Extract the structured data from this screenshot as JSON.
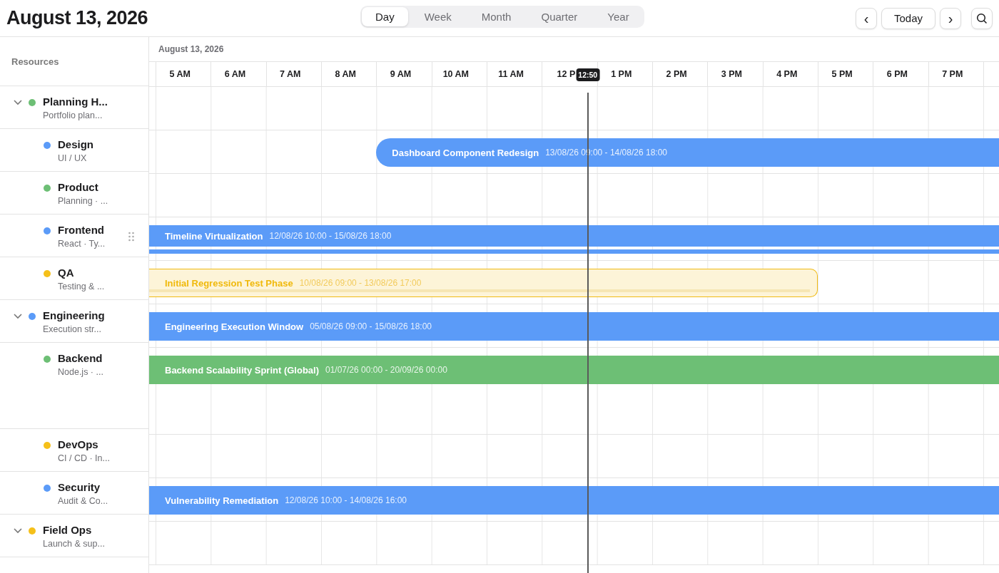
{
  "title": "August 13, 2026",
  "views": [
    {
      "label": "Day",
      "selected": true
    },
    {
      "label": "Week",
      "selected": false
    },
    {
      "label": "Month",
      "selected": false
    },
    {
      "label": "Quarter",
      "selected": false
    },
    {
      "label": "Year",
      "selected": false
    }
  ],
  "nav": {
    "prev": "‹",
    "today": "Today",
    "next": "›"
  },
  "sidebar_header": "Resources",
  "timeline": {
    "date": "August 13, 2026",
    "hours": [
      "5 AM",
      "6 AM",
      "7 AM",
      "8 AM",
      "9 AM",
      "10 AM",
      "11 AM",
      "12 P",
      "1 PM",
      "2 PM",
      "3 PM",
      "4 PM",
      "5 PM",
      "6 PM",
      "7 PM"
    ],
    "now": "12:50"
  },
  "groups": [
    {
      "name": "Planning H...",
      "subtitle": "Portfolio plan...",
      "color": "#6dbf75",
      "expanded": true,
      "children": [
        {
          "name": "Design",
          "subtitle": "UI / UX",
          "color": "#5b9bf8",
          "hovered": false,
          "events": [
            {
              "kind": "solid",
              "title": "Dashboard Component Redesign",
              "dates": "13/08/26 09:00 - 14/08/26 18:00",
              "color": "#5b9bf8"
            }
          ]
        },
        {
          "name": "Product",
          "subtitle": "Planning · ...",
          "color": "#6dbf75",
          "hovered": false
        },
        {
          "name": "Frontend",
          "subtitle": "React · Ty...",
          "color": "#5b9bf8",
          "hovered": true,
          "events": [
            {
              "kind": "solid",
              "title": "Timeline Virtualization",
              "dates": "12/08/26 10:00 - 15/08/26 18:00",
              "color": "#5b9bf8"
            },
            {
              "kind": "strip",
              "color": "#5b9bf8"
            }
          ]
        },
        {
          "name": "QA",
          "subtitle": "Testing & ...",
          "color": "#f5c01a",
          "hovered": false,
          "events": [
            {
              "kind": "outline",
              "title": "Initial Regression Test Phase",
              "dates": "10/08/26 09:00 - 13/08/26 17:00",
              "color": "#f0bb15"
            }
          ]
        }
      ]
    },
    {
      "name": "Engineering",
      "subtitle": "Execution str...",
      "color": "#5b9bf8",
      "expanded": true,
      "events": [
        {
          "kind": "solid",
          "title": "Engineering Execution Window",
          "dates": "05/08/26 09:00 - 15/08/26 18:00",
          "color": "#5b9bf8"
        }
      ],
      "children": [
        {
          "name": "Backend",
          "subtitle": "Node.js · ...",
          "color": "#6dbf75",
          "hovered": false,
          "tall": true,
          "events": [
            {
              "kind": "solid",
              "title": "Backend Scalability Sprint (Global)",
              "dates": "01/07/26 00:00 - 20/09/26 00:00",
              "color": "#6dbf75"
            }
          ]
        },
        {
          "name": "DevOps",
          "subtitle": "CI / CD · In...",
          "color": "#f5c01a",
          "hovered": false
        },
        {
          "name": "Security",
          "subtitle": "Audit & Co...",
          "color": "#5b9bf8",
          "hovered": false,
          "events": [
            {
              "kind": "solid",
              "title": "Vulnerability Remediation",
              "dates": "12/08/26 10:00 - 14/08/26 16:00",
              "color": "#5b9bf8"
            }
          ]
        }
      ]
    },
    {
      "name": "Field Ops",
      "subtitle": "Launch & sup...",
      "color": "#f5c01a",
      "expanded": true
    }
  ]
}
